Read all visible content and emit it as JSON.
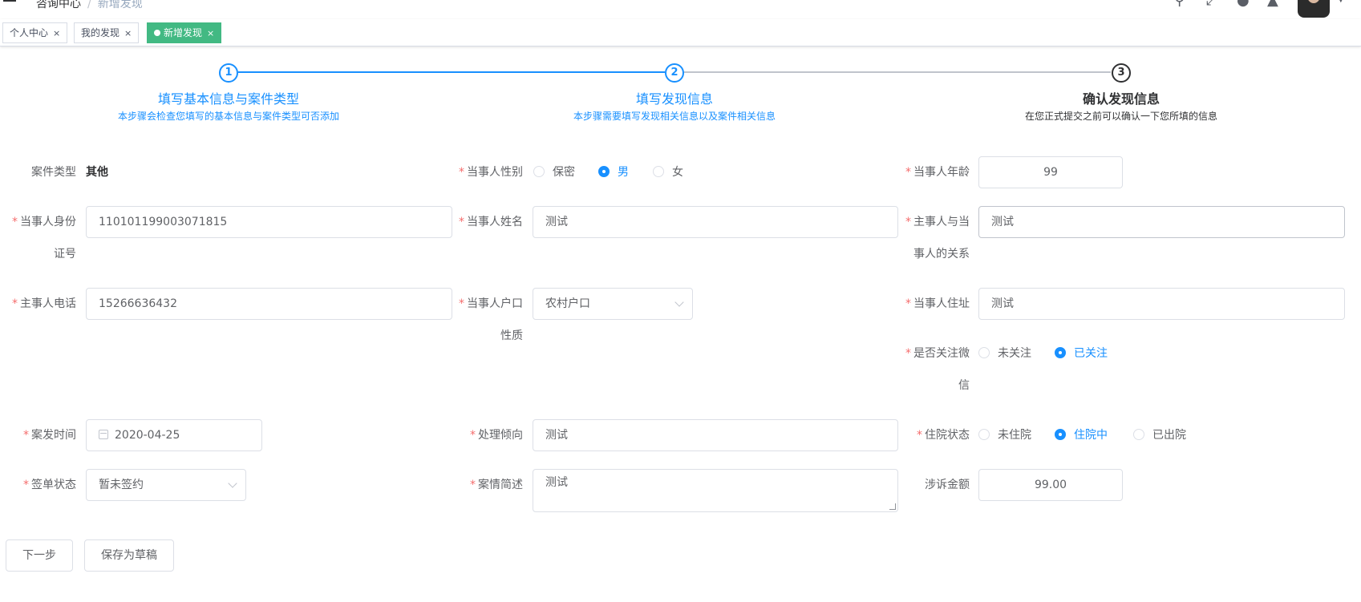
{
  "navbar": {
    "breadcrumb_root": "咨询中心",
    "breadcrumb_sep": "/",
    "breadcrumb_current": "新增发现"
  },
  "tags": [
    {
      "label": "个人中心",
      "close": "×"
    },
    {
      "label": "我的发现",
      "close": "×"
    },
    {
      "label": "新增发现",
      "close": "×"
    }
  ],
  "steps": [
    {
      "num": "1",
      "title": "填写基本信息与案件类型",
      "desc": "本步骤会检查您填写的基本信息与案件类型可否添加"
    },
    {
      "num": "2",
      "title": "填写发现信息",
      "desc": "本步骤需要填写发现相关信息以及案件相关信息"
    },
    {
      "num": "3",
      "title": "确认发现信息",
      "desc": "在您正式提交之前可以确认一下您所填的信息"
    }
  ],
  "colors": {
    "primary": "#1890ff",
    "tag_active": "#42b983",
    "required": "#f56c6c"
  },
  "form": {
    "case_type_label": "案件类型",
    "case_type_value": "其他",
    "gender_label": "当事人性别",
    "gender_options": [
      "保密",
      "男",
      "女"
    ],
    "gender_selected": "男",
    "age_label": "当事人年龄",
    "age_value": "99",
    "id_label_1": "当事人身份",
    "id_label_2": "证号",
    "id_value": "110101199003071815",
    "name_label": "当事人姓名",
    "name_value": "测试",
    "relation_label_1": "主事人与当",
    "relation_label_2": "事人的关系",
    "relation_value": "测试",
    "phone_label": "主事人电话",
    "phone_value": "15266636432",
    "household_label_1": "当事人户口",
    "household_label_2": "性质",
    "household_value": "农村户口",
    "address_label": "当事人住址",
    "address_value": "测试",
    "wechat_label_1": "是否关注微",
    "wechat_label_2": "信",
    "wechat_options": [
      "未关注",
      "已关注"
    ],
    "wechat_selected": "已关注",
    "incident_time_label": "案发时间",
    "incident_time_value": "2020-04-25",
    "tendency_label": "处理倾向",
    "tendency_value": "测试",
    "hospital_label": "住院状态",
    "hospital_options": [
      "未住院",
      "住院中",
      "已出院"
    ],
    "hospital_selected": "住院中",
    "sign_label": "签单状态",
    "sign_value": "暂未签约",
    "brief_label": "案情简述",
    "brief_value": "测试",
    "amount_label": "涉诉金额",
    "amount_value": "99.00"
  },
  "buttons": {
    "next": "下一步",
    "save_draft": "保存为草稿"
  }
}
